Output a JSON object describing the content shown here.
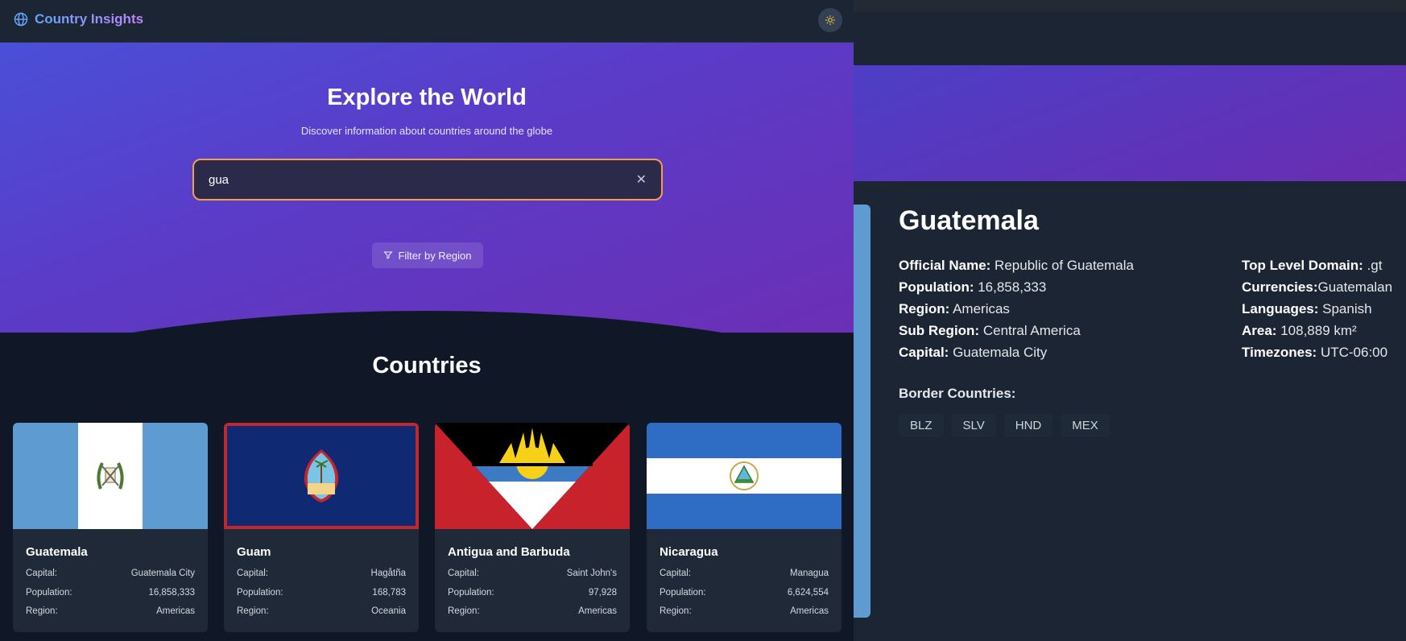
{
  "app": {
    "title": "Country Insights",
    "logo_icon": "globe-icon",
    "theme_icon": "sun-icon"
  },
  "hero": {
    "title": "Explore the World",
    "subtitle": "Discover information about countries around the globe",
    "search_value": "gua",
    "filter_label": "Filter by Region"
  },
  "section": {
    "title": "Countries"
  },
  "labels": {
    "capital": "Capital:",
    "population": "Population:",
    "region": "Region:"
  },
  "cards": [
    {
      "name": "Guatemala",
      "capital": "Guatemala City",
      "population": "16,858,333",
      "region": "Americas"
    },
    {
      "name": "Guam",
      "capital": "Hagåtña",
      "population": "168,783",
      "region": "Oceania"
    },
    {
      "name": "Antigua and Barbuda",
      "capital": "Saint John's",
      "population": "97,928",
      "region": "Americas"
    },
    {
      "name": "Nicaragua",
      "capital": "Managua",
      "population": "6,624,554",
      "region": "Americas"
    }
  ],
  "detail": {
    "name": "Guatemala",
    "left": [
      {
        "label": "Official Name:",
        "value": "Republic of Guatemala"
      },
      {
        "label": "Population:",
        "value": "16,858,333"
      },
      {
        "label": "Region:",
        "value": "Americas"
      },
      {
        "label": "Sub Region:",
        "value": "Central America"
      },
      {
        "label": "Capital:",
        "value": "Guatemala City"
      }
    ],
    "right": [
      {
        "label": "Top Level Domain:",
        "value": ".gt"
      },
      {
        "label": "Currencies:",
        "value": "Guatemalan"
      },
      {
        "label": "Languages:",
        "value": "Spanish"
      },
      {
        "label": "Area:",
        "value": "108,889 km²"
      },
      {
        "label": "Timezones:",
        "value": "UTC-06:00"
      }
    ],
    "border_title": "Border Countries:",
    "borders": [
      "BLZ",
      "SLV",
      "HND",
      "MEX"
    ]
  },
  "colors": {
    "accent": "#f59e4a",
    "hero_start": "#4a4fd8",
    "hero_end": "#6b2fb5",
    "card_bg": "#1f2937"
  }
}
